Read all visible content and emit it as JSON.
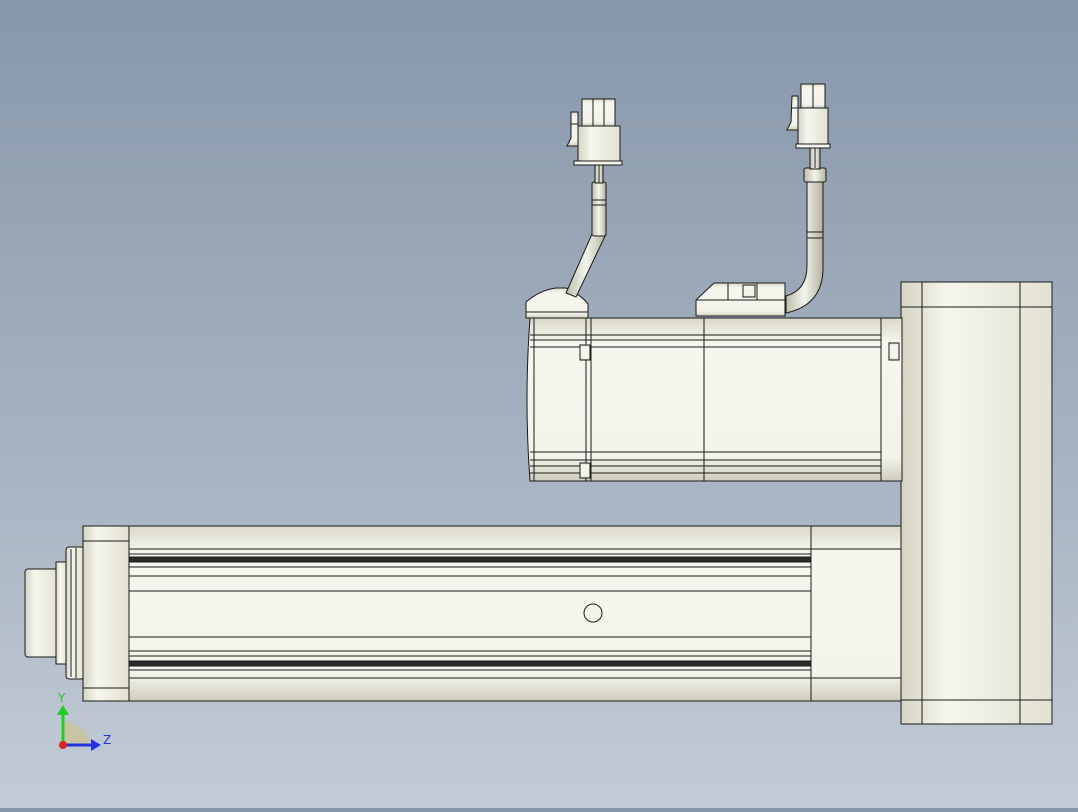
{
  "viewport": {
    "background_top": "#8797aa",
    "background_bottom": "#c3ccd6",
    "part_fill": "#eeeeE2",
    "part_edge": "#1a1a1a"
  },
  "triad": {
    "y_label": "Y",
    "z_label": "Z",
    "y_color": "#22cc22",
    "z_color": "#2233dd",
    "x_color": "#dd2222"
  }
}
